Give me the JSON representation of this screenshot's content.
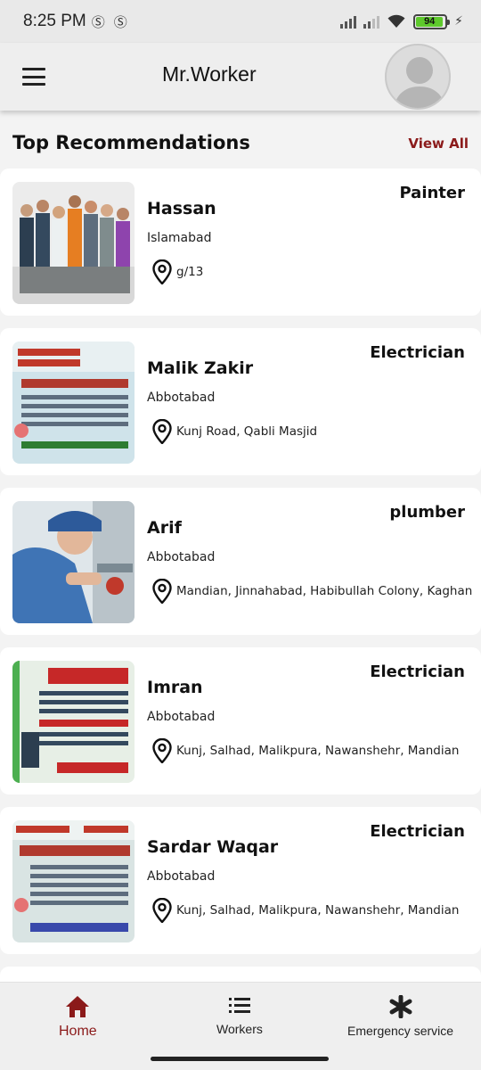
{
  "status_bar": {
    "time": "8:25 PM",
    "battery_level": "94"
  },
  "app_bar": {
    "title": "Mr.Worker"
  },
  "section": {
    "title": "Top Recommendations",
    "view_all_label": "View All"
  },
  "workers": [
    {
      "name": "Hassan",
      "category": "Painter",
      "city": "Islamabad",
      "address": "g/13"
    },
    {
      "name": "Malik Zakir",
      "category": "Electrician",
      "city": "Abbotabad",
      "address": "Kunj Road, Qabli Masjid"
    },
    {
      "name": "Arif",
      "category": "plumber",
      "city": "Abbotabad",
      "address": "Mandian, Jinnahabad, Habibullah Colony, Kaghan"
    },
    {
      "name": "Imran",
      "category": "Electrician",
      "city": "Abbotabad",
      "address": "Kunj, Salhad, Malikpura, Nawanshehr, Mandian"
    },
    {
      "name": "Sardar Waqar",
      "category": "Electrician",
      "city": "Abbotabad",
      "address": "Kunj, Salhad, Malikpura, Nawanshehr, Mandian"
    }
  ],
  "bottom_nav": {
    "items": [
      {
        "label": "Home",
        "icon": "home-icon"
      },
      {
        "label": "Workers",
        "icon": "list-icon"
      },
      {
        "label": "Emergency service",
        "icon": "asterisk-icon"
      }
    ],
    "active": "Home"
  },
  "colors": {
    "accent": "#8b1a1a",
    "card_background": "#ffffff",
    "page_background": "#f3f3f3"
  }
}
